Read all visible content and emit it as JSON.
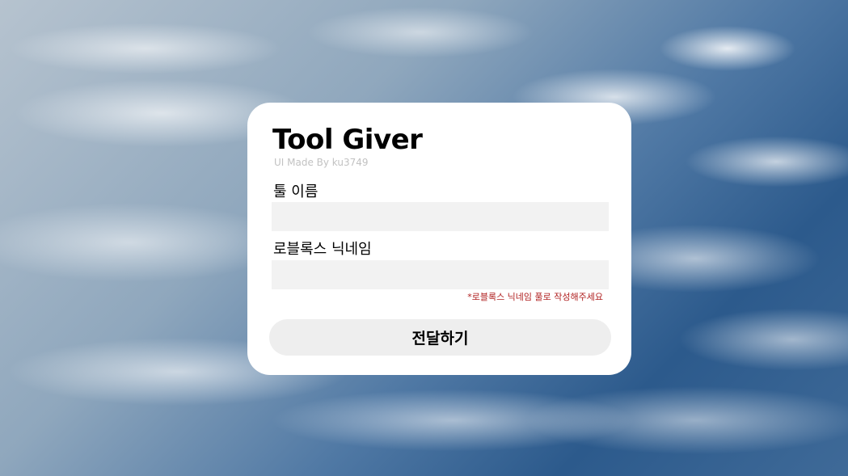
{
  "form": {
    "title": "Tool Giver",
    "subtitle": "UI Made By ku3749",
    "tool_name_label": "툴 이름",
    "tool_name_value": "",
    "nickname_label": "로블록스 닉네임",
    "nickname_value": "",
    "nickname_hint": "*로블록스 닉네임 풀로 작성해주세요",
    "submit_label": "전달하기"
  },
  "colors": {
    "card_background": "#ffffff",
    "input_background": "#f2f2f2",
    "button_background": "#eeeeee",
    "hint_text": "#b02020",
    "subtitle_text": "#c2c2c2"
  }
}
